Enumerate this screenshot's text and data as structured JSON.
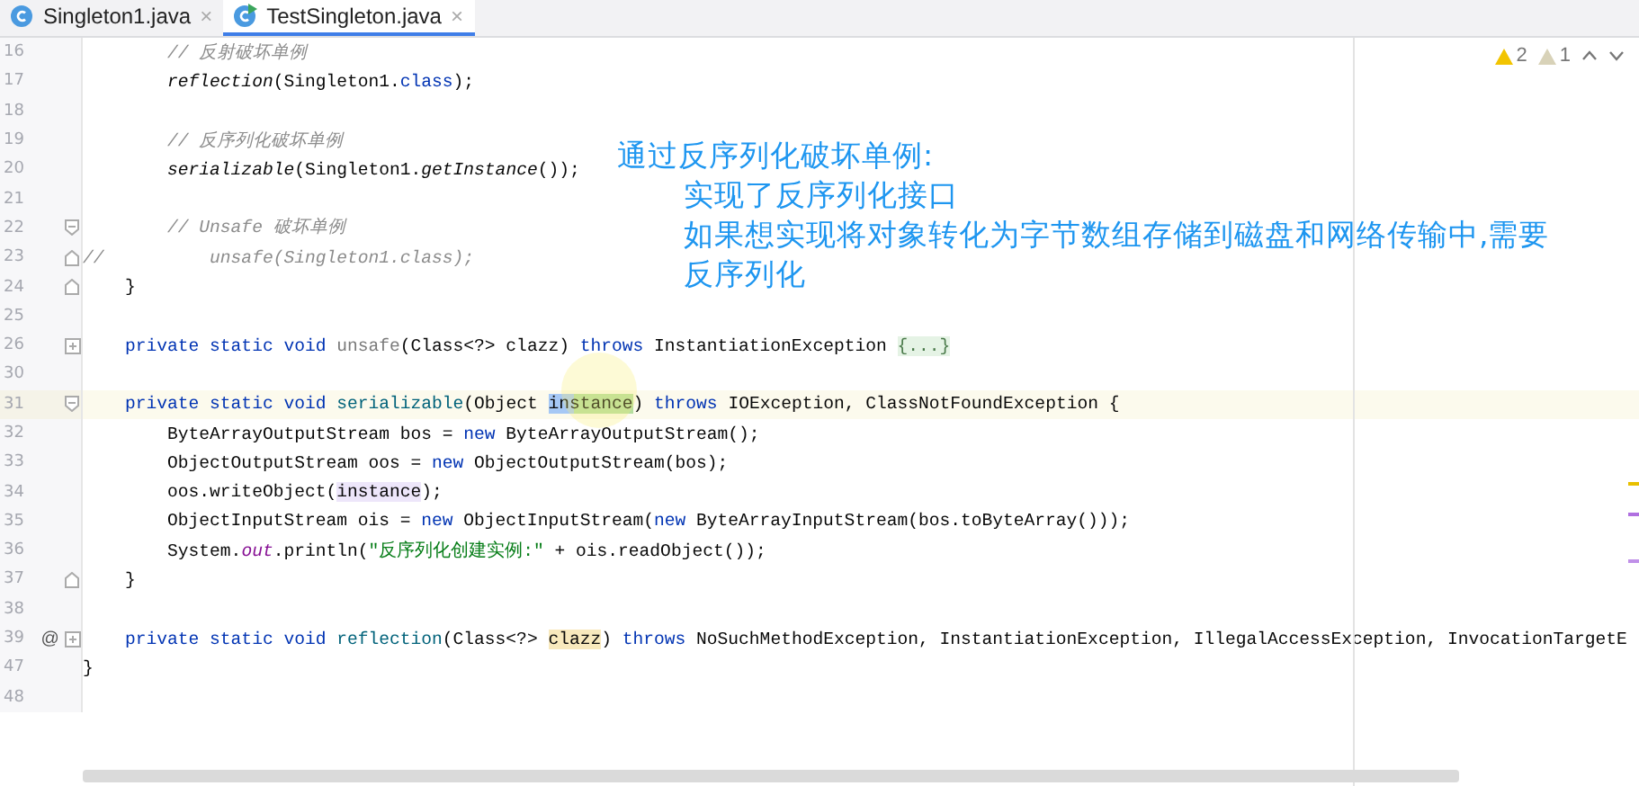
{
  "tabs": [
    {
      "label": "Singleton1.java",
      "selected": false,
      "close": "×",
      "run": false
    },
    {
      "label": "TestSingleton.java",
      "selected": true,
      "close": "×",
      "run": true
    }
  ],
  "inspections": [
    {
      "kind": "warning",
      "count": "2"
    },
    {
      "kind": "weak",
      "count": "1"
    }
  ],
  "lines": [
    {
      "number": "16",
      "current": false,
      "segments": [
        {
          "text": "        // 反射破坏单例",
          "kind": "comment"
        }
      ]
    },
    {
      "number": "17",
      "current": false,
      "segments": [
        {
          "text": "        reflection",
          "kind": "static"
        },
        {
          "text": "(Singleton1.",
          "kind": "plain"
        },
        {
          "text": "class",
          "kind": "keyword"
        },
        {
          "text": ");",
          "kind": "plain"
        }
      ]
    },
    {
      "number": "18",
      "current": false
    },
    {
      "number": "19",
      "current": false,
      "segments": [
        {
          "text": "        // 反序列化破坏单例",
          "kind": "comment"
        }
      ]
    },
    {
      "number": "20",
      "current": false,
      "segments": [
        {
          "text": "        serializable",
          "kind": "static"
        },
        {
          "text": "(Singleton1.",
          "kind": "plain"
        },
        {
          "text": "getInstance",
          "kind": "static"
        },
        {
          "text": "());",
          "kind": "plain"
        }
      ]
    },
    {
      "number": "21",
      "current": false
    },
    {
      "number": "22",
      "current": false,
      "fold": {
        "kind": "start"
      },
      "segments": [
        {
          "text": "        // Unsafe 破坏单例",
          "kind": "comment"
        }
      ]
    },
    {
      "number": "23",
      "current": false,
      "fold": {
        "kind": "end"
      },
      "segments": [
        {
          "text": "//          unsafe(Singleton1.class);",
          "kind": "comment"
        }
      ]
    },
    {
      "number": "24",
      "current": false,
      "fold": {
        "kind": "end"
      },
      "segments": [
        {
          "text": "    }",
          "kind": "plain"
        }
      ]
    },
    {
      "number": "25",
      "current": false
    },
    {
      "number": "26",
      "current": false,
      "fold": {
        "kind": "collapsed"
      },
      "segments": [
        {
          "text": "    private static void ",
          "kind": "keyword"
        },
        {
          "text": "unsafe",
          "kind": "unused"
        },
        {
          "text": "(Class<?> clazz) ",
          "kind": "plain"
        },
        {
          "text": "throws",
          "kind": "keyword"
        },
        {
          "text": " InstantiationException ",
          "kind": "plain"
        },
        {
          "text": "{...}",
          "kind": "folded"
        }
      ]
    },
    {
      "number": "30",
      "current": false
    },
    {
      "number": "31",
      "current": true,
      "fold": {
        "kind": "start"
      },
      "segments": [
        {
          "text": "    private static void ",
          "kind": "keyword"
        },
        {
          "text": "serializable",
          "kind": "decl"
        },
        {
          "text": "(Object ",
          "kind": "plain"
        },
        {
          "text": "instance",
          "kind": "selected"
        },
        {
          "text": ") ",
          "kind": "plain"
        },
        {
          "text": "throws",
          "kind": "keyword"
        },
        {
          "text": " IOException, ClassNotFoundException {",
          "kind": "plain"
        }
      ]
    },
    {
      "number": "32",
      "current": false,
      "segments": [
        {
          "text": "        ByteArrayOutputStream bos = ",
          "kind": "plain"
        },
        {
          "text": "new",
          "kind": "keyword"
        },
        {
          "text": " ByteArrayOutputStream();",
          "kind": "plain"
        }
      ]
    },
    {
      "number": "33",
      "current": false,
      "segments": [
        {
          "text": "        ObjectOutputStream oos = ",
          "kind": "plain"
        },
        {
          "text": "new",
          "kind": "keyword"
        },
        {
          "text": " ObjectOutputStream(bos);",
          "kind": "plain"
        }
      ]
    },
    {
      "number": "34",
      "current": false,
      "segments": [
        {
          "text": "        oos.writeObject(",
          "kind": "plain"
        },
        {
          "text": "instance",
          "kind": "usage"
        },
        {
          "text": ");",
          "kind": "plain"
        }
      ]
    },
    {
      "number": "35",
      "current": false,
      "segments": [
        {
          "text": "        ObjectInputStream ois = ",
          "kind": "plain"
        },
        {
          "text": "new",
          "kind": "keyword"
        },
        {
          "text": " ObjectInputStream(",
          "kind": "plain"
        },
        {
          "text": "new",
          "kind": "keyword"
        },
        {
          "text": " ByteArrayInputStream(bos.toByteArray()));",
          "kind": "plain"
        }
      ]
    },
    {
      "number": "36",
      "current": false,
      "segments": [
        {
          "text": "        System.",
          "kind": "plain"
        },
        {
          "text": "out",
          "kind": "field"
        },
        {
          "text": ".println(",
          "kind": "plain"
        },
        {
          "text": "\"反序列化创建实例:\"",
          "kind": "string"
        },
        {
          "text": " + ois.readObject());",
          "kind": "plain"
        }
      ]
    },
    {
      "number": "37",
      "current": false,
      "fold": {
        "kind": "end"
      },
      "segments": [
        {
          "text": "    }",
          "kind": "plain"
        }
      ]
    },
    {
      "number": "38",
      "current": false
    },
    {
      "number": "39",
      "current": false,
      "marker": "@",
      "fold": {
        "kind": "collapsed"
      },
      "segments": [
        {
          "text": "    private static void ",
          "kind": "keyword"
        },
        {
          "text": "reflection",
          "kind": "decl"
        },
        {
          "text": "(Class<?> ",
          "kind": "plain"
        },
        {
          "text": "clazz",
          "kind": "param"
        },
        {
          "text": ") ",
          "kind": "plain"
        },
        {
          "text": "throws",
          "kind": "keyword"
        },
        {
          "text": " NoSuchMethodException, InstantiationException, IllegalAccessException, InvocationTargetE",
          "kind": "plain"
        }
      ]
    },
    {
      "number": "47",
      "current": false,
      "segments": [
        {
          "text": "}",
          "kind": "plain"
        }
      ]
    },
    {
      "number": "48",
      "current": false
    }
  ],
  "annotation": [
    {
      "text": "通过反序列化破坏单例:",
      "indented": false
    },
    {
      "text": "实现了反序列化接口",
      "indented": true
    },
    {
      "text": "如果想实现将对象转化为字节数组存储到磁盘和网络传输中,需要",
      "indented": true
    },
    {
      "text": "反序列化",
      "indented": true
    }
  ]
}
